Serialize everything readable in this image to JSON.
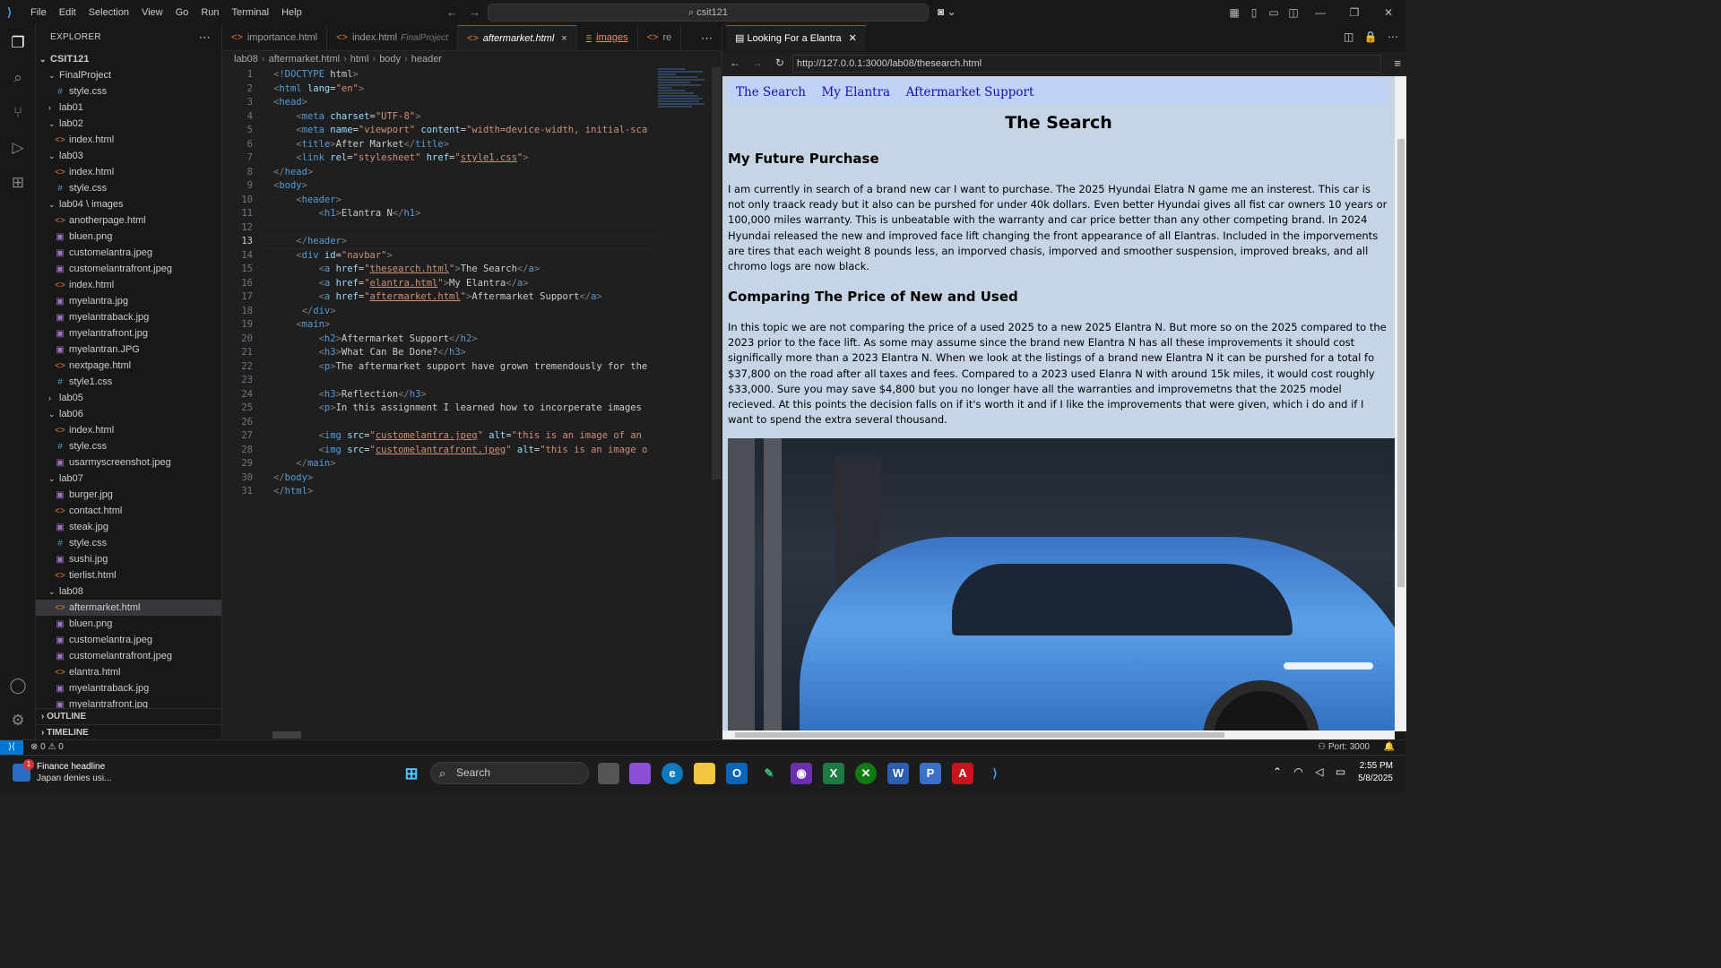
{
  "titlebar": {
    "menu": [
      "File",
      "Edit",
      "Selection",
      "View",
      "Go",
      "Run",
      "Terminal",
      "Help"
    ],
    "search_text": "csit121"
  },
  "sidebar": {
    "title": "EXPLORER",
    "root": "CSIT121",
    "items": [
      {
        "indent": 0,
        "type": "folder",
        "open": true,
        "label": "FinalProject"
      },
      {
        "indent": 1,
        "type": "css",
        "label": "style.css"
      },
      {
        "indent": 0,
        "type": "folder",
        "open": false,
        "label": "lab01"
      },
      {
        "indent": 0,
        "type": "folder",
        "open": true,
        "label": "lab02"
      },
      {
        "indent": 1,
        "type": "html",
        "label": "index.html"
      },
      {
        "indent": 0,
        "type": "folder",
        "open": true,
        "label": "lab03"
      },
      {
        "indent": 1,
        "type": "html",
        "label": "index.html"
      },
      {
        "indent": 1,
        "type": "css",
        "label": "style.css"
      },
      {
        "indent": 0,
        "type": "folder",
        "open": true,
        "label": "lab04 \\ images"
      },
      {
        "indent": 1,
        "type": "html",
        "label": "anotherpage.html"
      },
      {
        "indent": 1,
        "type": "img",
        "label": "bluen.png"
      },
      {
        "indent": 1,
        "type": "img",
        "label": "customelantra.jpeg"
      },
      {
        "indent": 1,
        "type": "img",
        "label": "customelantrafront.jpeg"
      },
      {
        "indent": 1,
        "type": "html",
        "label": "index.html"
      },
      {
        "indent": 1,
        "type": "img",
        "label": "myelantra.jpg"
      },
      {
        "indent": 1,
        "type": "img",
        "label": "myelantraback.jpg"
      },
      {
        "indent": 1,
        "type": "img",
        "label": "myelantrafront.jpg"
      },
      {
        "indent": 1,
        "type": "img",
        "label": "myelantran.JPG"
      },
      {
        "indent": 1,
        "type": "html",
        "label": "nextpage.html"
      },
      {
        "indent": 1,
        "type": "css",
        "label": "style1.css"
      },
      {
        "indent": 0,
        "type": "folder",
        "open": false,
        "label": "lab05"
      },
      {
        "indent": 0,
        "type": "folder",
        "open": true,
        "label": "lab06"
      },
      {
        "indent": 1,
        "type": "html",
        "label": "index.html"
      },
      {
        "indent": 1,
        "type": "css",
        "label": "style.css"
      },
      {
        "indent": 1,
        "type": "img",
        "label": "usarmyscreenshot.jpeg"
      },
      {
        "indent": 0,
        "type": "folder",
        "open": true,
        "label": "lab07"
      },
      {
        "indent": 1,
        "type": "img",
        "label": "burger.jpg"
      },
      {
        "indent": 1,
        "type": "html",
        "label": "contact.html"
      },
      {
        "indent": 1,
        "type": "img",
        "label": "steak.jpg"
      },
      {
        "indent": 1,
        "type": "css",
        "label": "style.css"
      },
      {
        "indent": 1,
        "type": "img",
        "label": "sushi.jpg"
      },
      {
        "indent": 1,
        "type": "html",
        "label": "tierlist.html"
      },
      {
        "indent": 0,
        "type": "folder",
        "open": true,
        "label": "lab08"
      },
      {
        "indent": 1,
        "type": "html",
        "label": "aftermarket.html",
        "selected": true
      },
      {
        "indent": 1,
        "type": "img",
        "label": "bluen.png"
      },
      {
        "indent": 1,
        "type": "img",
        "label": "customelantra.jpeg"
      },
      {
        "indent": 1,
        "type": "img",
        "label": "customelantrafront.jpeg"
      },
      {
        "indent": 1,
        "type": "html",
        "label": "elantra.html"
      },
      {
        "indent": 1,
        "type": "img",
        "label": "myelantraback.jpg"
      },
      {
        "indent": 1,
        "type": "img",
        "label": "myelantrafront.jpg"
      }
    ],
    "outline_label": "OUTLINE",
    "timeline_label": "TIMELINE"
  },
  "editor": {
    "tabs": [
      {
        "label": "importance.html",
        "state": "normal",
        "icon": "html-icon"
      },
      {
        "label": "index.html",
        "sub": "FinalProject",
        "state": "normal",
        "icon": "html-icon"
      },
      {
        "label": "aftermarket.html",
        "state": "active",
        "icon": "html-icon",
        "close": "×"
      },
      {
        "label": "images",
        "state": "error",
        "icon": "list-icon"
      },
      {
        "label": "re",
        "state": "normal",
        "icon": "html-icon"
      }
    ],
    "breadcrumb": [
      "lab08",
      "aftermarket.html",
      "html",
      "body",
      "header"
    ],
    "current_line": 13,
    "lines": [
      "<!DOCTYPE html>",
      "<html lang=\"en\">",
      "<head>",
      "    <meta charset=\"UTF-8\">",
      "    <meta name=\"viewport\" content=\"width=device-width, initial-sca",
      "    <title>After Market</title>",
      "    <link rel=\"stylesheet\" href=\"style1.css\">",
      "</head>",
      "<body>",
      "    <header>",
      "        <h1>Elantra N</h1>",
      "",
      "    </header>",
      "    <div id=\"navbar\">",
      "        <a href=\"thesearch.html\">The Search</a>",
      "        <a href=\"elantra.html\">My Elantra</a>",
      "        <a href=\"aftermarket.html\">Aftermarket Support</a>",
      "     </div>",
      "    <main>",
      "        <h2>Aftermarket Support</h2>",
      "        <h3>What Can Be Done?</h3>",
      "        <p>The aftermarket support have grown tremendously for the",
      "",
      "        <h3>Reflection</h3>",
      "        <p>In this assignment I learned how to incorperate images",
      "",
      "        <img src=\"customelantra.jpeg\" alt=\"this is an image of an",
      "        <img src=\"customelantrafront.jpeg\" alt=\"this is an image o",
      "    </main>",
      "</body>",
      "</html>"
    ]
  },
  "preview": {
    "tab_title": "Looking For a Elantra",
    "url": "http://127.0.0.1:3000/lab08/thesearch.html",
    "nav_links": [
      "The Search",
      "My Elantra",
      "Aftermarket Support"
    ],
    "h1": "The Search",
    "h2_1": "My Future Purchase",
    "p1": "I am currently in search of a brand new car I want to purchase. The 2025 Hyundai Elatra N game me an insterest. This car is not only traack ready but it also can be purshed for under 40k dollars. Even better Hyundai gives all fist car owners 10 years or 100,000 miles warranty. This is unbeatable with the warranty and car price better than any other competing brand. In 2024 Hyundai released the new and improved face lift changing the front appearance of all Elantras. Included in the imporvements are tires that each weight 8 pounds less, an imporved chasis, imporved and smoother suspension, improved breaks, and all chromo logs are now black.",
    "h2_2": "Comparing The Price of New and Used",
    "p2": "In this topic we are not comparing the price of a used 2025 to a new 2025 Elantra N. But more so on the 2025 compared to the 2023 prior to the face lift. As some may assume since the brand new Elantra N has all these improvements it should cost significally more than a 2023 Elantra N. When we look at the listings of a brand new Elantra N it can be purshed for a total fo $37,800 on the road after all taxes and fees. Compared to a 2023 used Elanra N with around 15k miles, it would cost roughly $33,000. Sure you may save $4,800 but you no longer have all the warranties and improvemetns that the 2025 model recieved. At this points the decision falls on if it's worth it and if I like the improvements that were given, which i do and if I want to spend the extra several thousand."
  },
  "statusbar": {
    "errors": "0",
    "warnings": "0",
    "port": "Port: 3000"
  },
  "taskbar": {
    "news_title": "Finance headline",
    "news_sub": "Japan denies usi...",
    "news_badge": "1",
    "search_placeholder": "Search",
    "time": "2:55 PM",
    "date": "5/8/2025"
  },
  "colors": {
    "accent": "#0078d4",
    "page_bg": "#c5d5e6",
    "navbar_bg": "#bfd3f7",
    "link": "#1a0dab"
  }
}
